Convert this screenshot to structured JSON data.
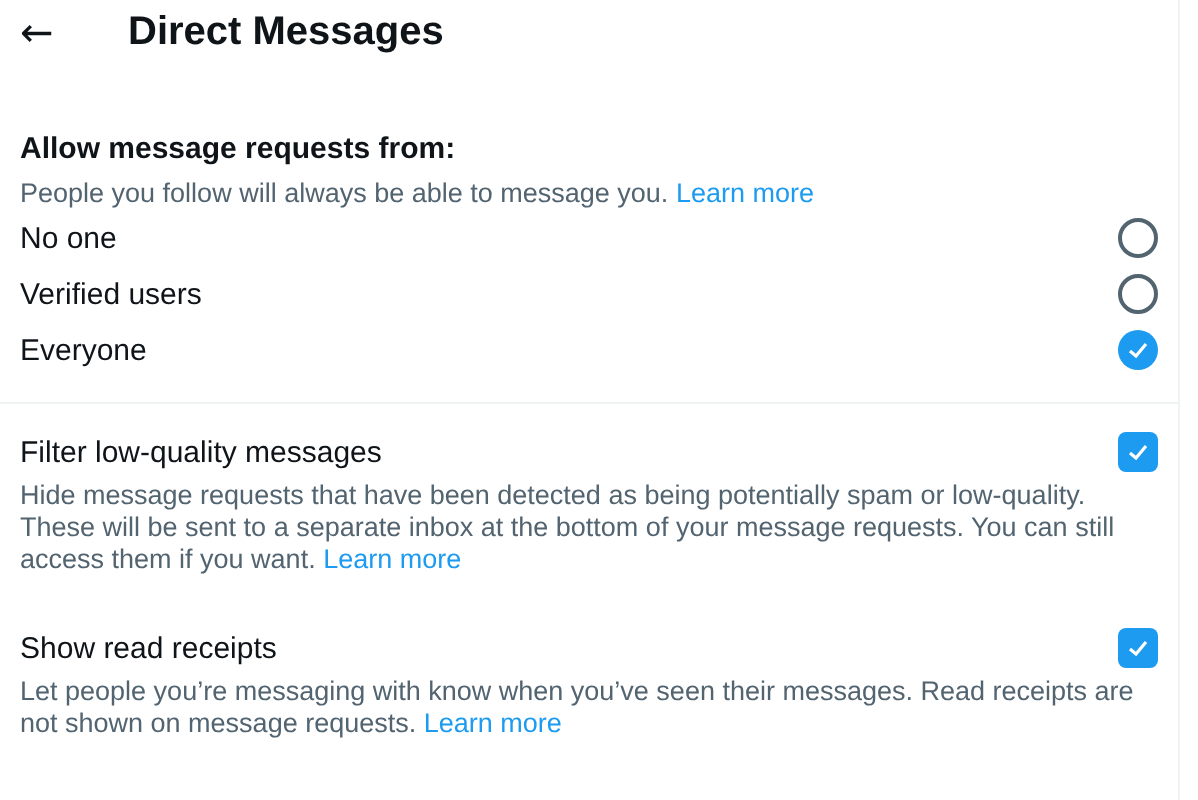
{
  "header": {
    "back": "←",
    "title": "Direct Messages"
  },
  "requests": {
    "heading": "Allow message requests from:",
    "note": "People you follow will always be able to message you.",
    "link": "Learn more",
    "options": [
      {
        "label": "No one",
        "selected": false
      },
      {
        "label": "Verified users",
        "selected": false
      },
      {
        "label": "Everyone",
        "selected": true
      }
    ]
  },
  "settings": [
    {
      "label": "Filter low-quality messages",
      "checked": true,
      "description": "Hide message requests that have been detected as being potentially spam or low-quality. These will be sent to a separate inbox at the bottom of your message requests. You can still access them if you want.",
      "link": "Learn more"
    },
    {
      "label": "Show read receipts",
      "checked": true,
      "description": "Let people you’re messaging with know when you’ve seen their messages. Read receipts are not shown on message requests.",
      "link": "Learn more"
    }
  ]
}
